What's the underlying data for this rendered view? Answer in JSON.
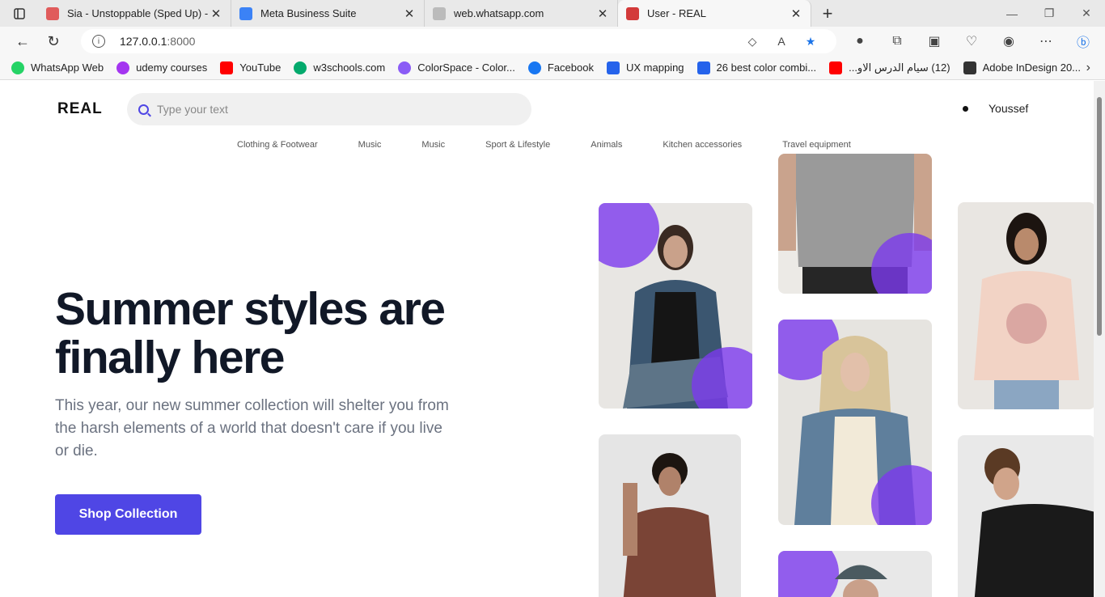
{
  "browser": {
    "tabs": [
      {
        "title": "Sia - Unstoppable (Sped Up) - Yo",
        "color": "#e05b5b"
      },
      {
        "title": "Meta Business Suite",
        "color": "#3b82f6"
      },
      {
        "title": "web.whatsapp.com",
        "color": "#888888"
      },
      {
        "title": "User - REAL",
        "color": "#d33a3a"
      }
    ],
    "url_host": "127.0.0.1",
    "url_port": ":8000",
    "bookmarks": [
      {
        "label": "WhatsApp Web",
        "color": "#25d366"
      },
      {
        "label": "udemy courses",
        "color": "#a435f0"
      },
      {
        "label": "YouTube",
        "color": "#ff0000"
      },
      {
        "label": "w3schools.com",
        "color": "#04aa6d"
      },
      {
        "label": "ColorSpace - Color...",
        "color": "#8b5cf6"
      },
      {
        "label": "Facebook",
        "color": "#1877f2"
      },
      {
        "label": "UX mapping",
        "color": "#2563eb"
      },
      {
        "label": "26 best color combi...",
        "color": "#2563eb"
      },
      {
        "label": "(12) سيام الدرس الاو...",
        "color": "#ff0000"
      },
      {
        "label": "Adobe InDesign 20...",
        "color": "#111111"
      }
    ]
  },
  "site": {
    "logo": "REAL",
    "search_placeholder": "Type your text",
    "user_name": "Youssef",
    "categories": [
      "Clothing & Footwear",
      "Music",
      "Music",
      "Sport & Lifestyle",
      "Animals",
      "Kitchen accessories",
      "Travel equipment"
    ],
    "hero_title": "Summer styles are finally here",
    "hero_subtitle": "This year, our new summer collection will shelter you from the harsh elements of a world that doesn't care if you live or die.",
    "cta_label": "Shop Collection",
    "accent": "#4f46e5"
  }
}
